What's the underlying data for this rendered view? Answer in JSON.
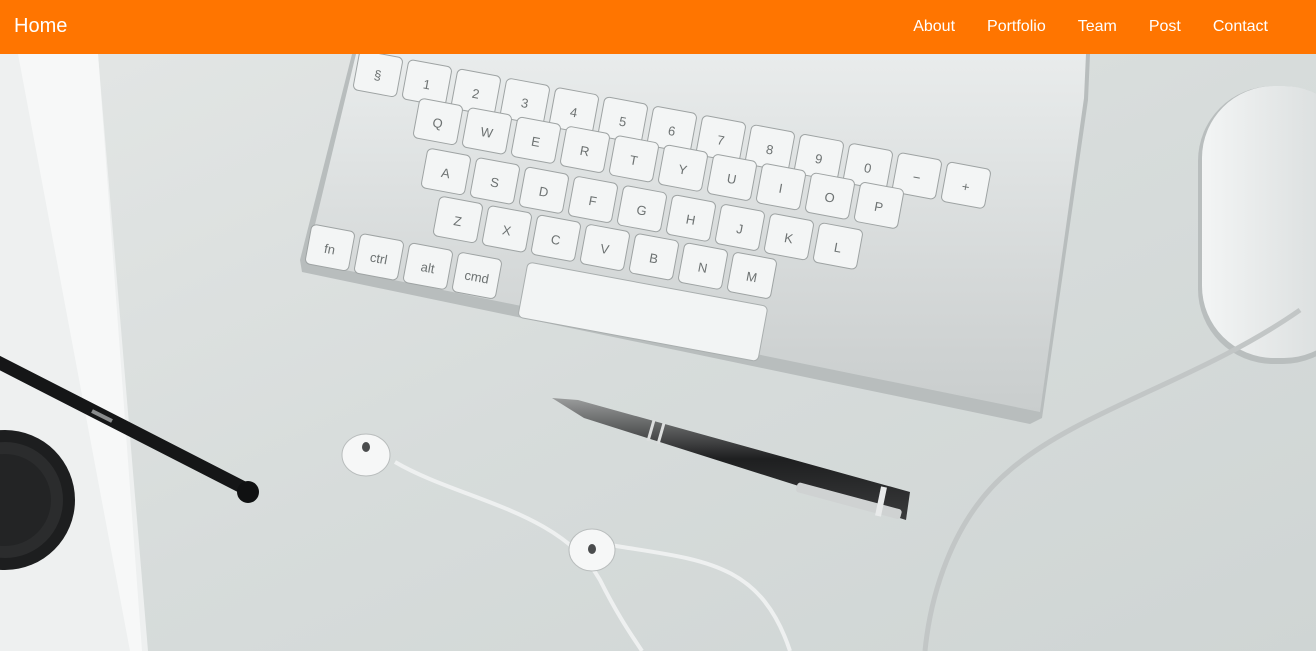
{
  "navbar": {
    "brand": "Home",
    "links": [
      {
        "label": "About"
      },
      {
        "label": "Portfolio"
      },
      {
        "label": "Team"
      },
      {
        "label": "Post"
      },
      {
        "label": "Contact"
      }
    ]
  },
  "theme": {
    "navbar_color": "#ff7500",
    "nav_text_color": "#ffffff"
  },
  "hero": {
    "image_subject": "desk-with-keyboard-pen-earphones-mouse",
    "keyboard_keys": [
      "§",
      "1",
      "2",
      "3",
      "4",
      "5",
      "6",
      "7",
      "8",
      "9",
      "0",
      "−",
      "+",
      "Q",
      "W",
      "E",
      "R",
      "T",
      "Y",
      "U",
      "I",
      "O",
      "P",
      "A",
      "S",
      "D",
      "F",
      "G",
      "H",
      "J",
      "K",
      "L",
      "Z",
      "X",
      "C",
      "V",
      "B",
      "N",
      "M",
      "fn",
      "ctrl",
      "alt",
      "cmd",
      "⌘"
    ]
  }
}
